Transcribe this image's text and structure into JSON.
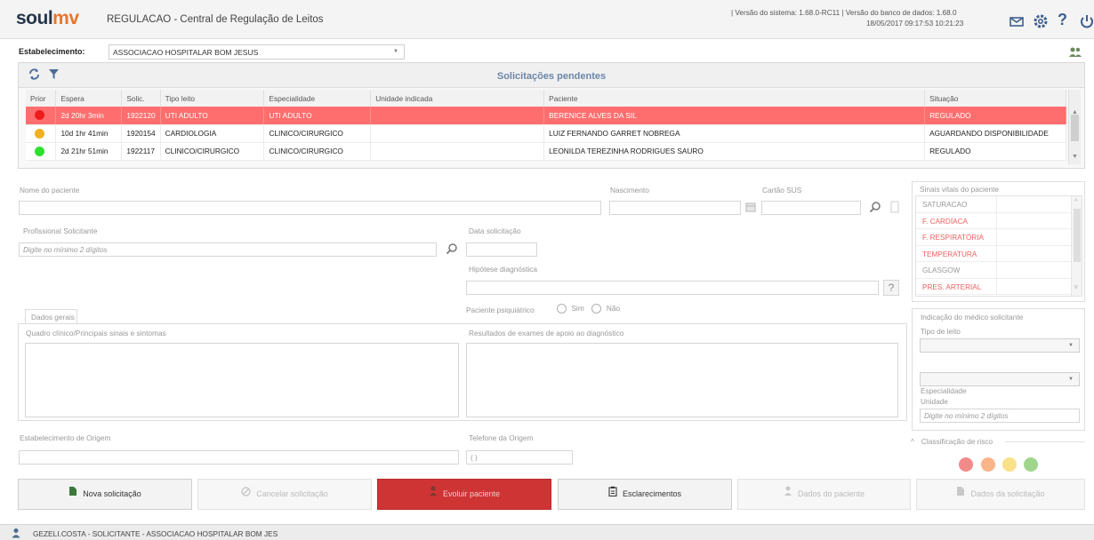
{
  "header": {
    "logo_soul": "soul",
    "logo_mv": "mv",
    "title": "REGULACAO - Central de Regulação de Leitos",
    "version": "| Versão do sistema: 1.68.0-RC11 | Versão do banco de dados: 1.68.0",
    "datetime": "18/05/2017 09:17:53   10:21:23"
  },
  "establishment": {
    "label": "Estabelecimento:",
    "value": "ASSOCIACAO HOSPITALAR BOM JESUS"
  },
  "pending": {
    "title": "Solicitações pendentes",
    "columns": [
      "Prior",
      "Espera",
      "Solic.",
      "Tipo leito",
      "Especialidade",
      "Unidade indicada",
      "Paciente",
      "Situação"
    ],
    "rows": [
      {
        "priority_color": "#ee1c1c",
        "espera": "2d 20hr 3min",
        "solic": "1922120",
        "tipo_leito": "UTI ADULTO",
        "especialidade": "UTI ADULTO",
        "unidade": "",
        "paciente": "BERENICE ALVES DA SIL",
        "situacao": "REGULADO"
      },
      {
        "priority_color": "#f0b020",
        "espera": "10d 1hr 41min",
        "solic": "1920154",
        "tipo_leito": "CARDIOLOGIA",
        "especialidade": "CLINICO/CIRURGICO",
        "unidade": "",
        "paciente": "LUIZ FERNANDO GARRET NOBREGA",
        "situacao": "AGUARDANDO DISPONIBILIDADE"
      },
      {
        "priority_color": "#2ee02e",
        "espera": "2d 21hr 51min",
        "solic": "1922117",
        "tipo_leito": "CLINICO/CIRURGICO",
        "especialidade": "CLINICO/CIRURGICO",
        "unidade": "",
        "paciente": "LEONILDA TEREZINHA RODRIGUES SAURO",
        "situacao": "REGULADO"
      }
    ]
  },
  "form": {
    "nome_paciente_label": "Nome do paciente",
    "nascimento_label": "Nascimento",
    "cartao_sus_label": "Cartão SUS",
    "profissional_label": "Profissional Solicitante",
    "profissional_placeholder": "Digite no mínimo 2 dígitos",
    "data_solicitacao_label": "Data solicitação",
    "hipotese_label": "Hipótese diagnóstica",
    "psiquiatrico_label": "Paciente psiquiátrico",
    "sim_label": "Sim",
    "nao_label": "Não",
    "dados_gerais_tab": "Dados gerais",
    "quadro_clinico_label": "Quadro clínico/Principais sinais e sintomas",
    "resultados_label": "Resultados de exames de apoio ao diagnóstico",
    "estab_origem_label": "Estabelecimento de Origem",
    "telefone_label": "Telefone da Origem",
    "telefone_value": "(  )"
  },
  "vitals": {
    "title": "Sinais vitais do paciente",
    "items": [
      {
        "name": "SATURACAO",
        "color": "#999999"
      },
      {
        "name": "F. CARDÍACA",
        "color": "#f06060"
      },
      {
        "name": "F. RESPIRATÓRIA",
        "color": "#f06060"
      },
      {
        "name": "TEMPERATURA",
        "color": "#f06060"
      },
      {
        "name": "GLASGOW",
        "color": "#999999"
      },
      {
        "name": "PRES. ARTERIAL",
        "color": "#f06060"
      }
    ]
  },
  "indicacao": {
    "title": "Indicação do médico solicitante",
    "tipo_leito_label": "Tipo de leito",
    "especialidade_label": "Especialidade",
    "unidade_label": "Unidade",
    "unidade_placeholder": "Digite no mínimo 2 dígitos"
  },
  "risk": {
    "title": "Classificação de risco",
    "colors": [
      "#f28a8a",
      "#f9b489",
      "#fbe08a",
      "#9fd68c"
    ]
  },
  "buttons": {
    "nova": "Nova solicitação",
    "cancelar": "Cancelar solicitação",
    "evoluir": "Evoluir paciente",
    "esclarecimentos": "Esclarecimentos",
    "dados_paciente": "Dados do paciente",
    "dados_solicitacao": "Dados da solicitação"
  },
  "statusbar": {
    "user": "GEZELI.COSTA - SOLICITANTE - ASSOCIACAO HOSPITALAR BOM JES"
  },
  "colors": {
    "accent_blue": "#6b86a8",
    "selected_row": "#ff6e6e",
    "primary_button": "#cf3434",
    "logo_orange": "#e8762d"
  }
}
